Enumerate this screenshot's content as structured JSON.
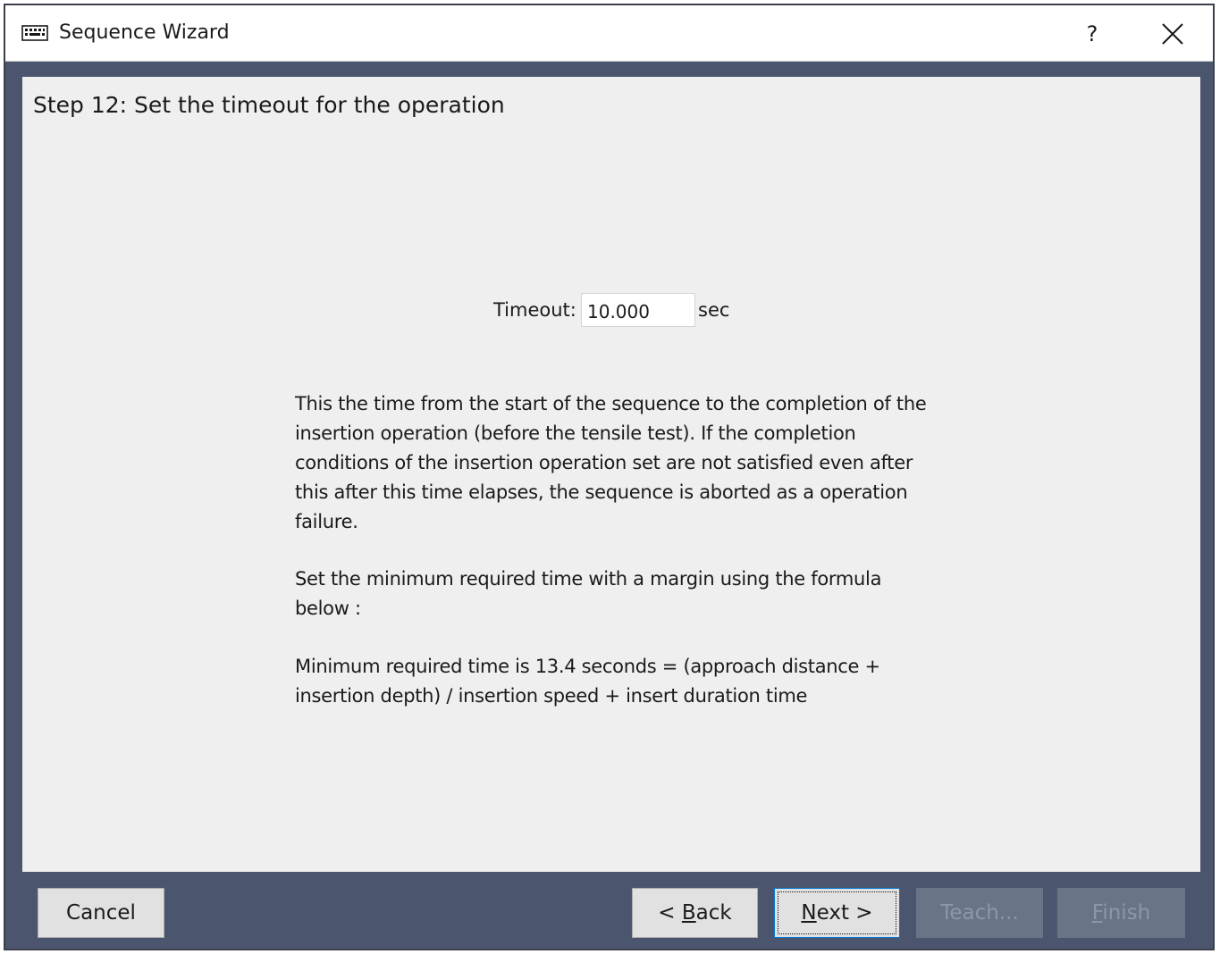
{
  "window": {
    "title": "Sequence Wizard",
    "help_label": "?",
    "icon": "keyboard-icon"
  },
  "step": {
    "title": "Step 12: Set the timeout for the operation"
  },
  "timeout": {
    "label": "Timeout:",
    "value": "10.000",
    "unit": "sec"
  },
  "description": {
    "paragraph1": "This the time from the start of the sequence to the completion of the insertion operation (before the tensile test).  If the completion conditions of the insertion operation set are not satisfied even after this after this time elapses, the sequence is aborted as a operation failure.",
    "paragraph2": "Set the minimum required time with a margin using the formula below :",
    "paragraph3": "Minimum required time is 13.4 seconds = (approach distance + insertion depth) / insertion speed + insert duration time"
  },
  "buttons": {
    "cancel": "Cancel",
    "back_prefix": "< ",
    "back_mnemonic": "B",
    "back_rest": "ack",
    "next_mnemonic": "N",
    "next_rest": "ext >",
    "teach": "Teach...",
    "finish_mnemonic": "F",
    "finish_rest": "inish"
  },
  "colors": {
    "frame": "#4b566e",
    "content_bg": "#efefef",
    "button_bg": "#e1e1e1",
    "disabled_button_bg": "#6a7487",
    "disabled_text": "#8e97a8",
    "focus_border": "#0078d7"
  }
}
